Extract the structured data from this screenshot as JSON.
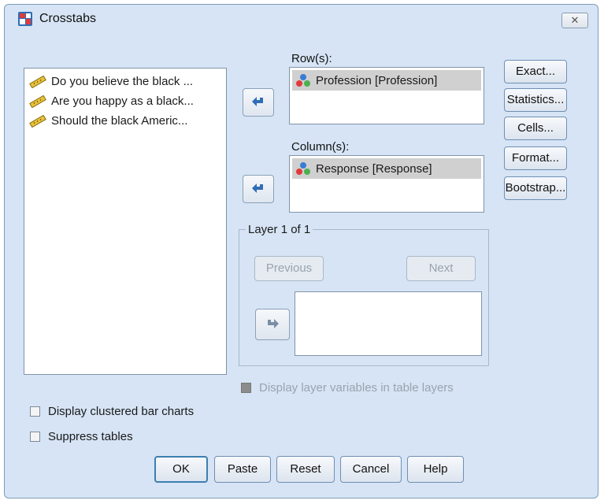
{
  "window": {
    "title": "Crosstabs",
    "close_label": "✕"
  },
  "source_variables": [
    "Do you believe the black ...",
    "Are you happy as a black...",
    "Should the black Americ..."
  ],
  "rows": {
    "label": "Row(s):",
    "items": [
      "Profession [Profession]"
    ]
  },
  "columns": {
    "label": "Column(s):",
    "items": [
      "Response [Response]"
    ]
  },
  "side_buttons": {
    "exact": "Exact...",
    "statistics": "Statistics...",
    "cells": "Cells...",
    "format": "Format...",
    "bootstrap": "Bootstrap..."
  },
  "layer": {
    "legend": "Layer 1 of 1",
    "previous": "Previous",
    "next": "Next"
  },
  "options": {
    "display_layer_vars": "Display layer variables in table layers",
    "clustered_bar": "Display clustered bar charts",
    "suppress_tables": "Suppress tables"
  },
  "bottom_buttons": {
    "ok": "OK",
    "paste": "Paste",
    "reset": "Reset",
    "cancel": "Cancel",
    "help": "Help"
  },
  "icons": {
    "variable": "ruler-scale-icon",
    "nominal": "nominal-balls-icon",
    "move": "arrow-icon"
  }
}
